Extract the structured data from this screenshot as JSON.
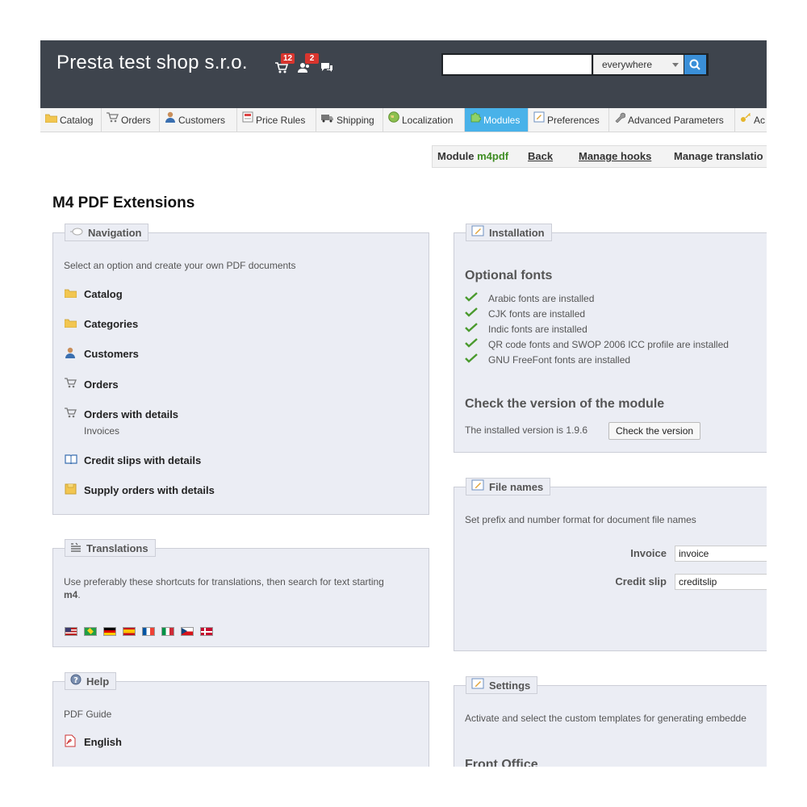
{
  "header": {
    "shop_name": "Presta test shop s.r.o.",
    "notifications": {
      "orders_count": "12",
      "customers_count": "2"
    },
    "search": {
      "value": "",
      "scope": "everywhere"
    }
  },
  "nav": {
    "tabs": [
      {
        "label": "Catalog",
        "icon": "folder-icon"
      },
      {
        "label": "Orders",
        "icon": "cart-icon"
      },
      {
        "label": "Customers",
        "icon": "user-icon"
      },
      {
        "label": "Price Rules",
        "icon": "price-tag-icon"
      },
      {
        "label": "Shipping",
        "icon": "truck-icon"
      },
      {
        "label": "Localization",
        "icon": "globe-icon"
      },
      {
        "label": "Modules",
        "icon": "puzzle-icon",
        "active": true
      },
      {
        "label": "Preferences",
        "icon": "form-icon"
      },
      {
        "label": "Advanced Parameters",
        "icon": "wrench-icon"
      },
      {
        "label": "Ac",
        "icon": "key-icon"
      }
    ]
  },
  "toolbar": {
    "module_prefix": "Module",
    "module_name": "m4pdf",
    "back": "Back",
    "manage_hooks": "Manage hooks",
    "manage_translations": "Manage translatio"
  },
  "page_title": "M4 PDF Extensions",
  "navigation_panel": {
    "legend": "Navigation",
    "intro": "Select an option and create your own PDF documents",
    "links": [
      {
        "label": "Catalog",
        "icon": "folder-icon"
      },
      {
        "label": "Categories",
        "icon": "folder-icon"
      },
      {
        "label": "Customers",
        "icon": "user-icon"
      },
      {
        "label": "Orders",
        "icon": "cart-icon"
      },
      {
        "label": "Orders with details",
        "sub": "Invoices",
        "icon": "cart-icon"
      },
      {
        "label": "Credit slips with details",
        "icon": "book-icon"
      },
      {
        "label": "Supply orders with details",
        "icon": "box-icon"
      }
    ]
  },
  "translations_panel": {
    "legend": "Translations",
    "text": "Use preferably these shortcuts for translations, then search for text starting",
    "keyword": "m4",
    "keyword_suffix": ".",
    "flags": [
      "flag-us-icon",
      "flag-br-icon",
      "flag-de-icon",
      "flag-es-icon",
      "flag-fr-icon",
      "flag-it-icon",
      "flag-cz-icon",
      "flag-dk-icon"
    ]
  },
  "help_panel": {
    "legend": "Help",
    "guide": "PDF Guide",
    "link": "English"
  },
  "installation_panel": {
    "legend": "Installation",
    "fonts_title": "Optional fonts",
    "fonts": [
      "Arabic fonts are installed",
      "CJK fonts are installed",
      "Indic fonts are installed",
      "QR code fonts and SWOP 2006 ICC profile are installed",
      "GNU FreeFont fonts are installed"
    ],
    "version_title": "Check the version of the module",
    "version_text": "The installed version is 1.9.6",
    "check_button": "Check the version"
  },
  "filenames_panel": {
    "legend": "File names",
    "intro": "Set prefix and number format for document file names",
    "invoice_label": "Invoice",
    "invoice_value": "invoice",
    "creditslip_label": "Credit slip",
    "creditslip_value": "creditslip"
  },
  "settings_panel": {
    "legend": "Settings",
    "intro": "Activate and select the custom templates for generating embedde",
    "front_office": "Front Office"
  },
  "colors": {
    "header_bg": "#3e444d",
    "active_tab": "#49b2e9",
    "panel_bg": "#ebedf4",
    "badge": "#d9352e",
    "module_name": "#3f8d23"
  }
}
